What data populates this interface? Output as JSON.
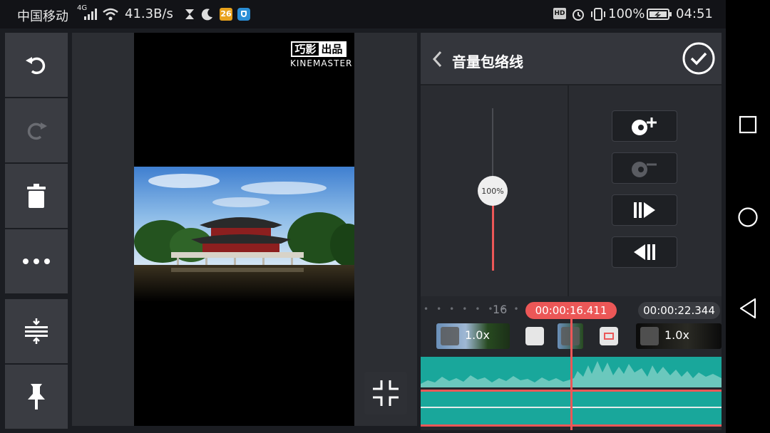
{
  "status_bar": {
    "carrier": "中国移动",
    "network": "4G",
    "speed": "41.3B/s",
    "badge": "26",
    "hd": "HD",
    "battery": "100%",
    "time": "04:51"
  },
  "preview": {
    "watermark_cn_left": "巧影",
    "watermark_cn_right": "出品",
    "watermark_en": "KINEMASTER"
  },
  "panel": {
    "title": "音量包络线",
    "volume_label": "100%",
    "volume_level_percent": 100
  },
  "timeline": {
    "ruler_number": "16",
    "current_time": "00:00:16.411",
    "total_duration": "00:00:22.344",
    "clip1_speed": "1.0x",
    "clip2_speed": "1.0x"
  },
  "colors": {
    "accent": "#ec5757",
    "waveform": "#19a79b",
    "toolbar_button": "#3a3c42",
    "panel_bg": "#2a2c31"
  },
  "icons": {
    "left_toolbar": [
      "undo-icon",
      "redo-icon",
      "delete-icon",
      "more-icon",
      "split-icon",
      "pin-icon"
    ],
    "keyframe_buttons": [
      "add-keyframe-icon",
      "remove-keyframe-icon",
      "next-keyframe-icon",
      "previous-keyframe-icon"
    ],
    "nav": [
      "recent-apps-icon",
      "home-icon",
      "back-icon"
    ]
  }
}
